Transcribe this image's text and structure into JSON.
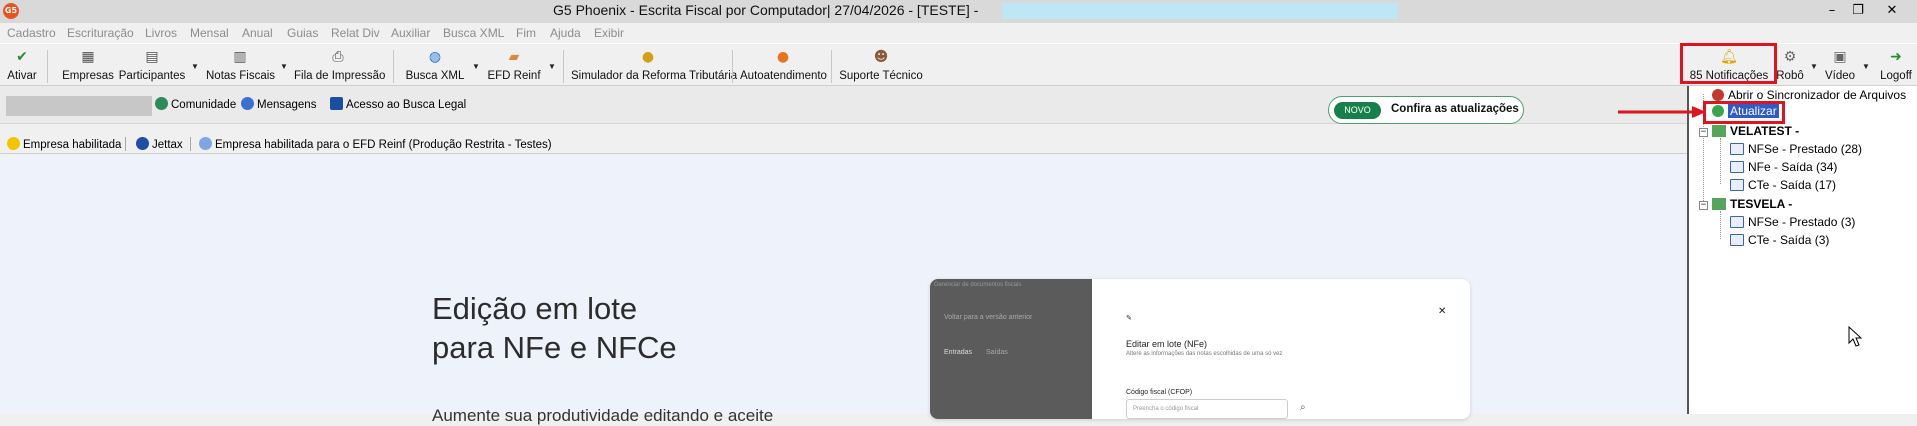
{
  "window": {
    "app_icon": "G5",
    "title": "G5 Phoenix - Escrita Fiscal por Computador|  27/04/2026 - [TESTE] -",
    "controls": [
      "minimize-icon",
      "restore-icon",
      "close-icon"
    ],
    "minimize_glyph": "–",
    "restore_glyph": "❐",
    "close_glyph": "✕"
  },
  "menu": [
    "Cadastro",
    "Escrituração",
    "Livros",
    "Mensal",
    "Anual",
    "Guias",
    "Relat Div",
    "Auxiliar",
    "Busca XML",
    "Fim",
    "Ajuda",
    "Exibir"
  ],
  "toolbar": {
    "ativar": "Ativar",
    "empresas": "Empresas",
    "participantes": "Participantes",
    "notas_fiscais": "Notas Fiscais",
    "fila_impressao": "Fila de Impressão",
    "busca_xml": "Busca XML",
    "efd_reinf": "EFD Reinf",
    "simulador": "Simulador da Reforma Tributária",
    "autoatendimento": "Autoatendimento",
    "suporte": "Suporte Técnico",
    "notificacoes": "85 Notificações",
    "robo": "Robô",
    "video": "Vídeo",
    "logoff": "Logoff",
    "dropdown_glyph": "▼"
  },
  "subbar": {
    "comunidade": "Comunidade",
    "mensagens": "Mensagens",
    "acesso_busca_legal": "Acesso ao Busca Legal",
    "novo_badge": "NOVO",
    "confira": "Confira as atualizações"
  },
  "status": {
    "empresa_habilitada": "Empresa habilitada",
    "jettax": "Jettax",
    "efd_reinf_habilitada": "Empresa habilitada para o EFD Reinf (Produção Restrita - Testes)"
  },
  "promo": {
    "title": "Edição em lote\npara NFe e NFCe",
    "body": "Aumente sua produtividade editando e aceite",
    "mock": {
      "side_header": "Gerenciar de documentos fiscais",
      "back": "Voltar para a versão anterior",
      "tab_entradas": "Entradas",
      "tab_saidas": "Saídas",
      "heading": "Editar em lote (NFe)",
      "subheading": "Altere as informações das notas escolhidas de uma só vez",
      "field_label": "Código fiscal (CFOP)",
      "field_placeholder": "Preencha o código fiscal",
      "close_glyph": "✕"
    }
  },
  "notifications_panel": {
    "sincronizador": "Abrir o Sincronizador de Arquivos",
    "atualizar": "Atualizar",
    "companies": [
      {
        "name": "VELATEST -",
        "items": [
          "NFSe - Prestado (28)",
          "NFe - Saída (34)",
          "CTe - Saída (17)"
        ]
      },
      {
        "name": "TESVELA -",
        "items": [
          "NFSe - Prestado (3)",
          "CTe - Saída (3)"
        ]
      }
    ],
    "collapse_glyph": "−"
  },
  "colors": {
    "highlight_red": "#e0141e",
    "selection_blue": "#2f5ac8",
    "novo_green": "#17804a",
    "content_bg": "#eef3fb"
  }
}
